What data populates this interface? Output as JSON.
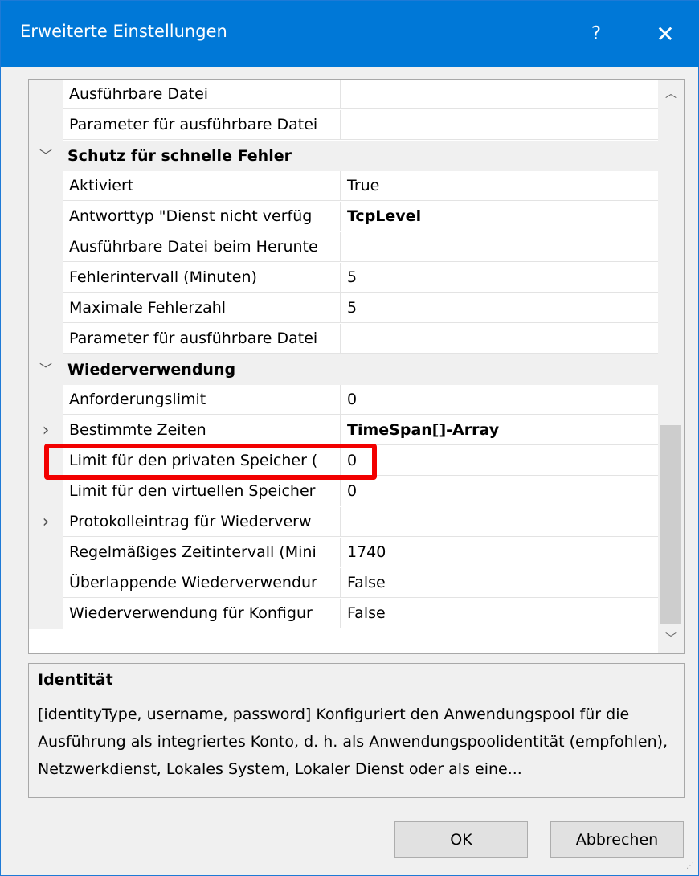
{
  "window": {
    "title": "Erweiterte Einstellungen",
    "help_glyph": "?",
    "close_glyph": "✕"
  },
  "grid": {
    "rows": [
      {
        "kind": "prop",
        "name": "Ausführbare Datei",
        "value": ""
      },
      {
        "kind": "prop",
        "name": "Parameter für ausführbare Datei",
        "value": ""
      },
      {
        "kind": "category",
        "name": "Schutz für schnelle Fehler",
        "expanded": true
      },
      {
        "kind": "prop",
        "name": "Aktiviert",
        "value": "True"
      },
      {
        "kind": "prop",
        "name": "Antworttyp \"Dienst nicht verfüg",
        "value": "TcpLevel",
        "bold": true
      },
      {
        "kind": "prop",
        "name": "Ausführbare Datei beim Herunte",
        "value": ""
      },
      {
        "kind": "prop",
        "name": "Fehlerintervall (Minuten)",
        "value": "5"
      },
      {
        "kind": "prop",
        "name": "Maximale Fehlerzahl",
        "value": "5"
      },
      {
        "kind": "prop",
        "name": "Parameter für ausführbare Datei",
        "value": ""
      },
      {
        "kind": "category",
        "name": "Wiederverwendung",
        "expanded": true
      },
      {
        "kind": "prop",
        "name": "Anforderungslimit",
        "value": "0"
      },
      {
        "kind": "prop",
        "name": "Bestimmte Zeiten",
        "value": "TimeSpan[]-Array",
        "bold": true,
        "expandable": true
      },
      {
        "kind": "prop",
        "name": "Limit für den privaten Speicher (",
        "value": "0",
        "highlighted": true
      },
      {
        "kind": "prop",
        "name": "Limit für den virtuellen Speicher",
        "value": "0"
      },
      {
        "kind": "prop",
        "name": "Protokolleintrag für Wiederverw",
        "value": "",
        "expandable": true
      },
      {
        "kind": "prop",
        "name": "Regelmäßiges Zeitintervall (Mini",
        "value": "1740"
      },
      {
        "kind": "prop",
        "name": "Überlappende Wiederverwendur",
        "value": "False"
      },
      {
        "kind": "prop",
        "name": "Wiederverwendung für Konfigur",
        "value": "False"
      }
    ]
  },
  "description": {
    "title": "Identität",
    "text": "[identityType, username, password] Konfiguriert den Anwendungspool für die Ausführung als integriertes Konto, d. h. als Anwendungspoolidentität (empfohlen), Netzwerkdienst, Lokales System, Lokaler Dienst oder als eine..."
  },
  "buttons": {
    "ok": "OK",
    "cancel": "Abbrechen"
  },
  "colors": {
    "titlebar": "#0078d7",
    "highlight_border": "#f20000"
  }
}
